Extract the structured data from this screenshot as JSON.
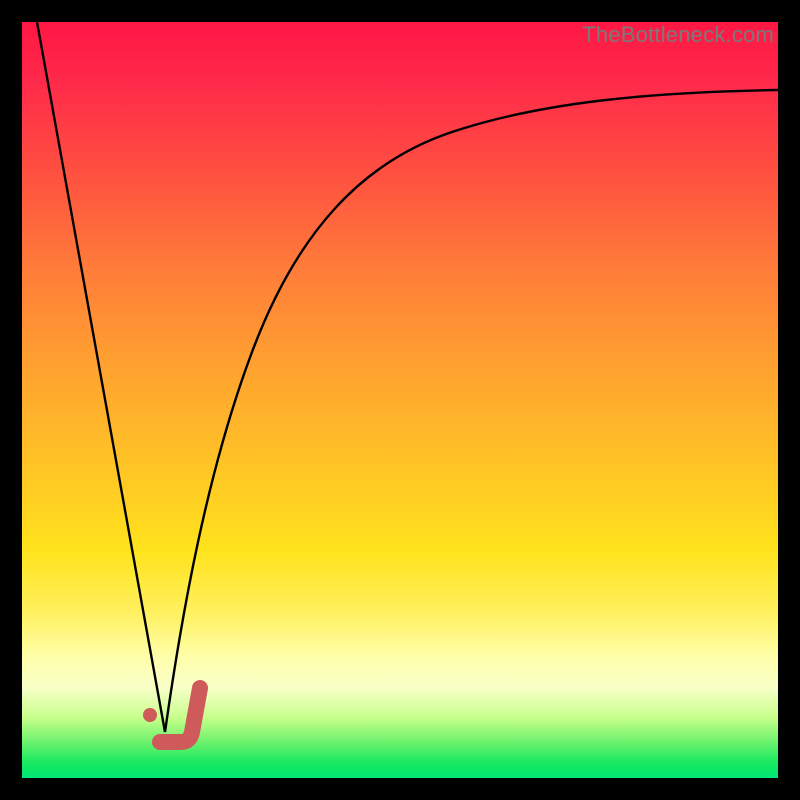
{
  "watermark": "TheBottleneck.com",
  "chart_data": {
    "type": "line",
    "title": "",
    "xlabel": "",
    "ylabel": "",
    "xlim": [
      0,
      100
    ],
    "ylim": [
      0,
      100
    ],
    "series": [
      {
        "name": "left-falling-line",
        "x": [
          2,
          19
        ],
        "y": [
          100,
          6
        ]
      },
      {
        "name": "rising-curve",
        "x": [
          19,
          22,
          26,
          30,
          35,
          42,
          50,
          60,
          72,
          86,
          100
        ],
        "y": [
          6,
          26,
          44,
          56,
          66,
          74,
          80,
          84,
          87,
          89,
          91
        ]
      }
    ],
    "annotations": [
      {
        "name": "checkmark",
        "approx_x": 20,
        "approx_y": 6
      },
      {
        "name": "dot",
        "approx_x": 17,
        "approx_y": 9
      }
    ],
    "background_gradient": {
      "orientation": "vertical",
      "stops": [
        {
          "pos": 0.0,
          "color": "#ff1744"
        },
        {
          "pos": 0.45,
          "color": "#ffa030"
        },
        {
          "pos": 0.78,
          "color": "#fff05e"
        },
        {
          "pos": 0.92,
          "color": "#c8ff8c"
        },
        {
          "pos": 1.0,
          "color": "#00e676"
        }
      ]
    }
  }
}
